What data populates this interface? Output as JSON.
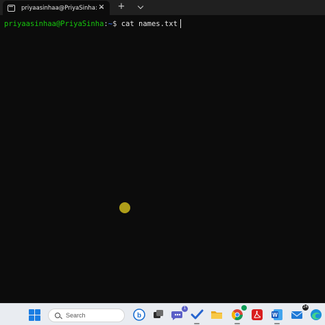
{
  "window": {
    "tab_title": "priyaasinhaa@PriyaSinha: ~",
    "close_glyph": "✕",
    "new_tab_glyph": "+"
  },
  "terminal": {
    "user_host": "priyaasinhaa@PriyaSinha",
    "separator": ":",
    "path": "~",
    "dollar": "$",
    "command": " cat names.txt"
  },
  "taskbar": {
    "search_placeholder": "Search",
    "teams_badge": "1",
    "mail_badge": "24",
    "icons": [
      "windows-start-icon",
      "search-icon",
      "bing-icon",
      "task-view-icon",
      "teams-chat-icon",
      "todo-icon",
      "file-explorer-icon",
      "chrome-icon",
      "acrobat-icon",
      "word-icon",
      "mail-icon",
      "edge-icon"
    ]
  },
  "colors": {
    "prompt_user": "#16c60c",
    "prompt_path": "#3b78ff",
    "terminal_bg": "#0c0c0c",
    "click_indicator": "#b8a61a"
  }
}
